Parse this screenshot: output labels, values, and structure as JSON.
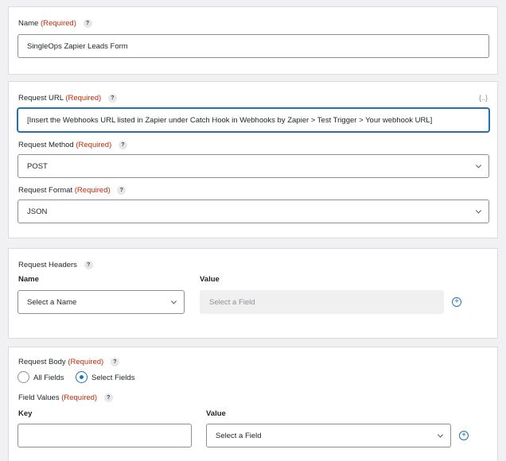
{
  "name_section": {
    "label": "Name",
    "required": "(Required)",
    "help": "?",
    "value": "SingleOps Zapier Leads Form"
  },
  "request_section": {
    "url_label": "Request URL",
    "url_required": "(Required)",
    "url_help": "?",
    "merge_tag": "{..}",
    "url_value": "[Insert the Webhooks URL listed in Zapier under Catch Hook in Webhooks by Zapier > Test Trigger > Your webhook URL]",
    "method_label": "Request Method",
    "method_required": "(Required)",
    "method_help": "?",
    "method_value": "POST",
    "format_label": "Request Format",
    "format_required": "(Required)",
    "format_help": "?",
    "format_value": "JSON"
  },
  "headers_section": {
    "label": "Request Headers",
    "help": "?",
    "name_col": "Name",
    "value_col": "Value",
    "name_select": "Select a Name",
    "value_placeholder": "Select a Field",
    "add": "+"
  },
  "body_section": {
    "label": "Request Body",
    "required": "(Required)",
    "help": "?",
    "option_all": "All Fields",
    "option_select": "Select Fields",
    "field_values_label": "Field Values",
    "field_values_required": "(Required)",
    "field_values_help": "?",
    "key_col": "Key",
    "value_col": "Value",
    "key_value": "",
    "value_select": "Select a Field",
    "add": "+"
  }
}
